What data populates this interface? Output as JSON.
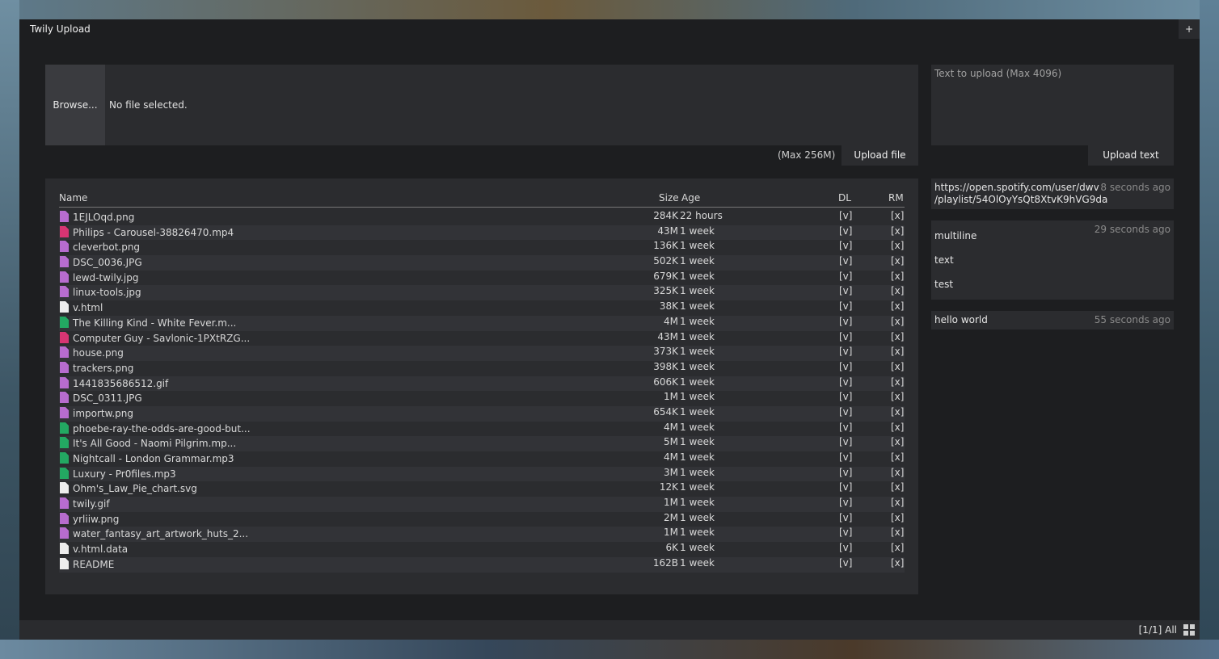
{
  "window": {
    "title": "Twily Upload",
    "corner_button": "+"
  },
  "file_upload": {
    "browse_label": "Browse...",
    "status": "No file selected.",
    "max_label": "(Max 256M)",
    "upload_label": "Upload file"
  },
  "text_upload": {
    "placeholder": "Text to upload (Max 4096)",
    "upload_label": "Upload text"
  },
  "table": {
    "headers": {
      "name": "Name",
      "size": "Size",
      "age": "Age",
      "dl": "DL",
      "rm": "RM"
    },
    "rows": [
      {
        "name": "1EJLOqd.png",
        "size": "284K",
        "age": "22 hours",
        "dl": "[v]",
        "rm": "[x]",
        "type": "image-file-icon"
      },
      {
        "name": "Philips - Carousel-38826470.mp4",
        "size": "43M",
        "age": "1 week",
        "dl": "[v]",
        "rm": "[x]",
        "type": "video-file-icon"
      },
      {
        "name": "cleverbot.png",
        "size": "136K",
        "age": "1 week",
        "dl": "[v]",
        "rm": "[x]",
        "type": "image-file-icon"
      },
      {
        "name": "DSC_0036.JPG",
        "size": "502K",
        "age": "1 week",
        "dl": "[v]",
        "rm": "[x]",
        "type": "image-file-icon"
      },
      {
        "name": "lewd-twily.jpg",
        "size": "679K",
        "age": "1 week",
        "dl": "[v]",
        "rm": "[x]",
        "type": "image-file-icon"
      },
      {
        "name": "linux-tools.jpg",
        "size": "325K",
        "age": "1 week",
        "dl": "[v]",
        "rm": "[x]",
        "type": "image-file-icon"
      },
      {
        "name": "v.html",
        "size": "38K",
        "age": "1 week",
        "dl": "[v]",
        "rm": "[x]",
        "type": "document-file-icon"
      },
      {
        "name": "The Killing Kind - White Fever.m...",
        "size": "4M",
        "age": "1 week",
        "dl": "[v]",
        "rm": "[x]",
        "type": "audio-file-icon"
      },
      {
        "name": "Computer Guy - Savlonic-1PXtRZG...",
        "size": "43M",
        "age": "1 week",
        "dl": "[v]",
        "rm": "[x]",
        "type": "video-file-icon"
      },
      {
        "name": "house.png",
        "size": "373K",
        "age": "1 week",
        "dl": "[v]",
        "rm": "[x]",
        "type": "image-file-icon"
      },
      {
        "name": "trackers.png",
        "size": "398K",
        "age": "1 week",
        "dl": "[v]",
        "rm": "[x]",
        "type": "image-file-icon"
      },
      {
        "name": "1441835686512.gif",
        "size": "606K",
        "age": "1 week",
        "dl": "[v]",
        "rm": "[x]",
        "type": "image-file-icon"
      },
      {
        "name": "DSC_0311.JPG",
        "size": "1M",
        "age": "1 week",
        "dl": "[v]",
        "rm": "[x]",
        "type": "image-file-icon"
      },
      {
        "name": "importw.png",
        "size": "654K",
        "age": "1 week",
        "dl": "[v]",
        "rm": "[x]",
        "type": "image-file-icon"
      },
      {
        "name": "phoebe-ray-the-odds-are-good-but...",
        "size": "4M",
        "age": "1 week",
        "dl": "[v]",
        "rm": "[x]",
        "type": "audio-file-icon"
      },
      {
        "name": "It's All Good - Naomi Pilgrim.mp...",
        "size": "5M",
        "age": "1 week",
        "dl": "[v]",
        "rm": "[x]",
        "type": "audio-file-icon"
      },
      {
        "name": "Nightcall - London Grammar.mp3",
        "size": "4M",
        "age": "1 week",
        "dl": "[v]",
        "rm": "[x]",
        "type": "audio-file-icon"
      },
      {
        "name": "Luxury - Pr0files.mp3",
        "size": "3M",
        "age": "1 week",
        "dl": "[v]",
        "rm": "[x]",
        "type": "audio-file-icon"
      },
      {
        "name": "Ohm's_Law_Pie_chart.svg",
        "size": "12K",
        "age": "1 week",
        "dl": "[v]",
        "rm": "[x]",
        "type": "document-file-icon"
      },
      {
        "name": "twily.gif",
        "size": "1M",
        "age": "1 week",
        "dl": "[v]",
        "rm": "[x]",
        "type": "image-file-icon"
      },
      {
        "name": "yrliiw.png",
        "size": "2M",
        "age": "1 week",
        "dl": "[v]",
        "rm": "[x]",
        "type": "image-file-icon"
      },
      {
        "name": "water_fantasy_art_artwork_huts_2...",
        "size": "1M",
        "age": "1 week",
        "dl": "[v]",
        "rm": "[x]",
        "type": "image-file-icon"
      },
      {
        "name": "v.html.data",
        "size": "6K",
        "age": "1 week",
        "dl": "[v]",
        "rm": "[x]",
        "type": "document-file-icon"
      },
      {
        "name": "README",
        "size": "162B",
        "age": "1 week",
        "dl": "[v]",
        "rm": "[x]",
        "type": "document-file-icon"
      }
    ]
  },
  "pastes": [
    {
      "text": "https://open.spotify.com/user/dwv\n/playlist/54OlOyYsQt8XtvK9hVG9da",
      "ago": "8 seconds ago"
    },
    {
      "text": "multiline\ntext\ntest",
      "ago": "29 seconds ago"
    },
    {
      "text": "hello world",
      "ago": "55 seconds ago"
    }
  ],
  "statusbar": {
    "text": "[1/1] All",
    "icon": "grid-layout-icon"
  },
  "colors": {
    "image": "#b76ccf",
    "video": "#d73573",
    "audio": "#23a862",
    "document": "#ededed"
  }
}
